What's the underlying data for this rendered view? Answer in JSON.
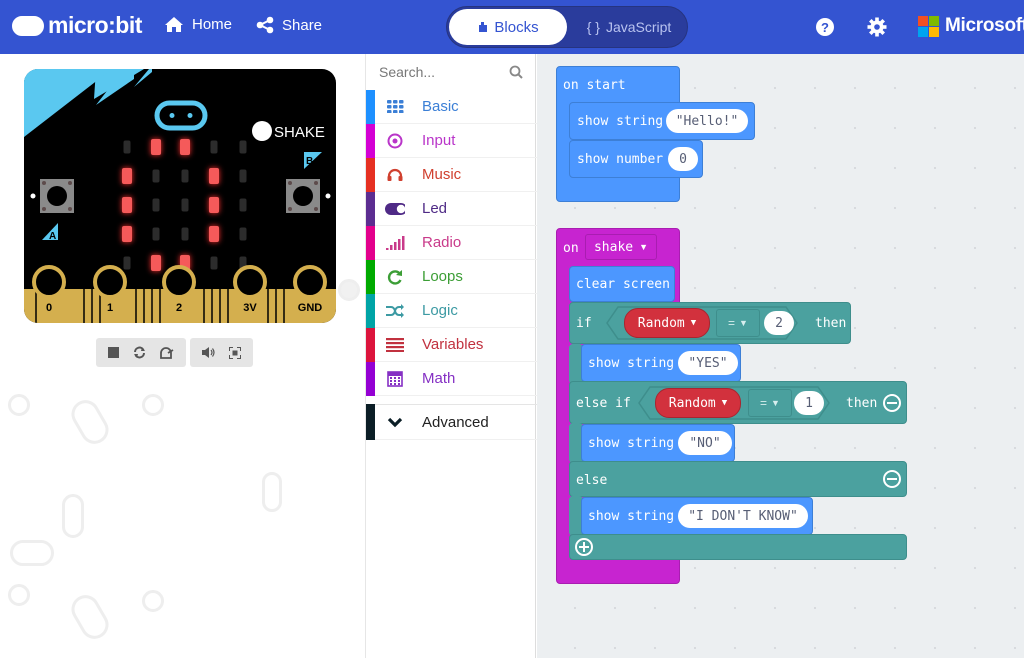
{
  "header": {
    "brand": "micro:bit",
    "nav": [
      {
        "label": "Home",
        "icon": "home-icon"
      },
      {
        "label": "Share",
        "icon": "share-icon"
      }
    ],
    "editor_toggle": {
      "blocks_label": "Blocks",
      "javascript_label": "JavaScript",
      "javascript_prefix": "{ }",
      "active": "Blocks"
    },
    "help_icon": "help-icon",
    "settings_icon": "gear-icon",
    "partner": "Microsoft",
    "colors": {
      "bar": "#3454D1"
    }
  },
  "simulator": {
    "shake_label": "SHAKE",
    "button_a": "A",
    "button_b": "B",
    "pins": [
      "0",
      "1",
      "2",
      "3V",
      "GND"
    ],
    "led_matrix": [
      [
        0,
        1,
        1,
        0,
        0
      ],
      [
        1,
        0,
        0,
        1,
        0
      ],
      [
        1,
        0,
        0,
        1,
        0
      ],
      [
        1,
        0,
        0,
        1,
        0
      ],
      [
        0,
        1,
        1,
        0,
        0
      ]
    ],
    "controls": [
      "stop-icon",
      "restart-icon",
      "slowmo-icon",
      "mute-icon",
      "fullscreen-icon"
    ]
  },
  "toolbox": {
    "search_placeholder": "Search...",
    "categories": [
      {
        "label": "Basic",
        "color": "#1E90FF",
        "text_color": "#3b7fd6",
        "icon": "grid-icon"
      },
      {
        "label": "Input",
        "color": "#D400D4",
        "text_color": "#b935c9",
        "icon": "target-icon"
      },
      {
        "label": "Music",
        "color": "#E63022",
        "text_color": "#d0402f",
        "icon": "headphones-icon"
      },
      {
        "label": "Led",
        "color": "#5C2D91",
        "text_color": "#4f2a86",
        "icon": "toggle-icon"
      },
      {
        "label": "Radio",
        "color": "#E3008C",
        "text_color": "#c93a8a",
        "icon": "signal-icon"
      },
      {
        "label": "Loops",
        "color": "#00AA00",
        "text_color": "#3c9e36",
        "icon": "loop-icon"
      },
      {
        "label": "Logic",
        "color": "#00A4A6",
        "text_color": "#3c9aa3",
        "icon": "shuffle-icon"
      },
      {
        "label": "Variables",
        "color": "#DC143C",
        "text_color": "#c1313f",
        "icon": "list-icon"
      },
      {
        "label": "Math",
        "color": "#9400D3",
        "text_color": "#8530c4",
        "icon": "calculator-icon"
      }
    ],
    "advanced": {
      "label": "Advanced",
      "color": "#0b1e26",
      "icon": "chevron-down-icon"
    }
  },
  "workspace": {
    "on_start": {
      "label": "on start",
      "statements": [
        {
          "label": "show string",
          "value": "\"Hello!\""
        },
        {
          "label": "show number",
          "value": "0"
        }
      ]
    },
    "on_shake": {
      "label": "on",
      "event": "shake",
      "clear": "clear screen",
      "if_label": "if",
      "if_var": "Random",
      "if_op": "=",
      "if_value": "2",
      "then_label": "then",
      "if_body": {
        "label": "show string",
        "value": "\"YES\""
      },
      "elseif_label": "else if",
      "elseif_var": "Random",
      "elseif_op": "=",
      "elseif_value": "1",
      "elseif_body": {
        "label": "show string",
        "value": "\"NO\""
      },
      "else_label": "else",
      "else_body": {
        "label": "show string",
        "value": "\"I DON'T KNOW\""
      }
    },
    "colors": {
      "basic": "#4C97FF",
      "input": "#C724D0",
      "logic": "#4BA19F",
      "variable": "#D2313D"
    }
  }
}
